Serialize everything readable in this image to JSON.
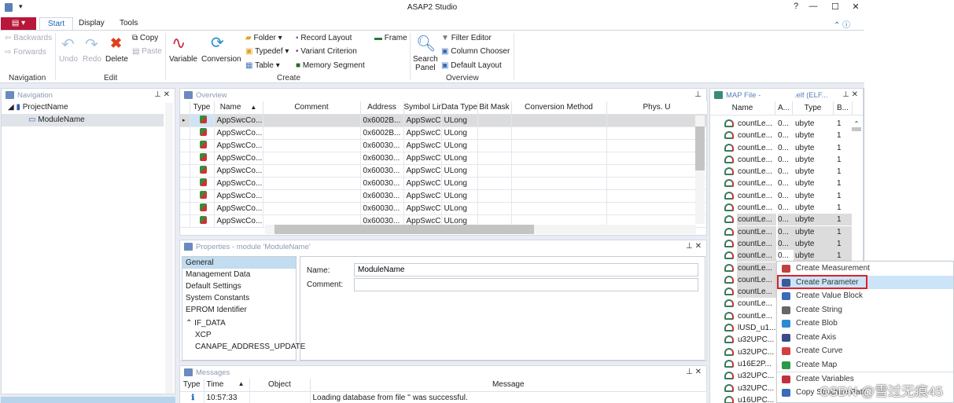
{
  "app": {
    "title": "ASAP2 Studio"
  },
  "tabs": [
    {
      "label": "Start"
    },
    {
      "label": "Display"
    },
    {
      "label": "Tools"
    }
  ],
  "ribbon": {
    "navigation": {
      "label": "Navigation",
      "backwards": "Backwards",
      "forwards": "Forwards"
    },
    "edit": {
      "label": "Edit",
      "undo": "Undo",
      "redo": "Redo",
      "delete": "Delete",
      "copy": "Copy",
      "paste": "Paste"
    },
    "create": {
      "label": "Create",
      "variable": "Variable",
      "conversion": "Conversion",
      "folder": "Folder",
      "typedef": "Typedef",
      "table": "Table",
      "record_layout": "Record Layout",
      "variant_criterion": "Variant Criterion",
      "memory_segment": "Memory Segment",
      "frame": "Frame"
    },
    "overview": {
      "label": "Overview",
      "search_panel_1": "Search",
      "search_panel_2": "Panel",
      "filter_editor": "Filter Editor",
      "column_chooser": "Column Chooser",
      "default_layout": "Default Layout"
    }
  },
  "navigation_panel": {
    "title": "Navigation",
    "tree": [
      {
        "label": "ProjectName"
      },
      {
        "label": "ModuleName"
      }
    ]
  },
  "overview_panel": {
    "title": "Overview",
    "columns": [
      "Type",
      "Name",
      "Comment",
      "Address",
      "Symbol Link",
      "Data Type",
      "Bit Mask",
      "Conversion Method",
      "Phys. U"
    ],
    "rows": [
      [
        "AppSwcCo...",
        "",
        "0x6002B...",
        "AppSwcC...",
        "ULong"
      ],
      [
        "AppSwcCo...",
        "",
        "0x6002B...",
        "AppSwcC...",
        "ULong"
      ],
      [
        "AppSwcCo...",
        "",
        "0x60030...",
        "AppSwcC...",
        "ULong"
      ],
      [
        "AppSwcCo...",
        "",
        "0x60030...",
        "AppSwcC...",
        "ULong"
      ],
      [
        "AppSwcCo...",
        "",
        "0x60030...",
        "AppSwcC...",
        "ULong"
      ],
      [
        "AppSwcCo...",
        "",
        "0x60030...",
        "AppSwcC...",
        "ULong"
      ],
      [
        "AppSwcCo...",
        "",
        "0x60030...",
        "AppSwcC...",
        "ULong"
      ],
      [
        "AppSwcCo...",
        "",
        "0x60030...",
        "AppSwcC...",
        "ULong"
      ],
      [
        "AppSwcCo...",
        "",
        "0x60030...",
        "AppSwcC...",
        "ULong"
      ]
    ]
  },
  "properties_panel": {
    "title": "Properties - module 'ModuleName'",
    "sections": [
      "General",
      "Management Data",
      "Default Settings",
      "System Constants",
      "EPROM Identifier"
    ],
    "if_data": {
      "label": "IF_DATA",
      "children": [
        "XCP",
        "CANAPE_ADDRESS_UPDATE"
      ]
    },
    "name_label": "Name:",
    "name_value": "ModuleName",
    "comment_label": "Comment:",
    "comment_value": ""
  },
  "messages_panel": {
    "title": "Messages",
    "columns": [
      "Type",
      "Time",
      "Object",
      "Message"
    ],
    "rows": [
      {
        "time": "10:57:33",
        "object": "",
        "message": "Loading database from file '' was successful."
      }
    ]
  },
  "map_panel": {
    "title": "MAP File - ",
    "title_suffix": ".elf (ELF...",
    "columns": [
      "Name",
      "A...",
      "Type",
      "B..."
    ],
    "rows": [
      [
        "countLe...",
        "0...",
        "ubyte",
        "1"
      ],
      [
        "countLe...",
        "0...",
        "ubyte",
        "1"
      ],
      [
        "countLe...",
        "0...",
        "ubyte",
        "1"
      ],
      [
        "countLe...",
        "0...",
        "ubyte",
        "1"
      ],
      [
        "countLe...",
        "0...",
        "ubyte",
        "1"
      ],
      [
        "countLe...",
        "0...",
        "ubyte",
        "1"
      ],
      [
        "countLe...",
        "0...",
        "ubyte",
        "1"
      ],
      [
        "countLe...",
        "0...",
        "ubyte",
        "1"
      ],
      [
        "countLe...",
        "0...",
        "ubyte",
        "1"
      ],
      [
        "countLe...",
        "0...",
        "ubyte",
        "1"
      ],
      [
        "countLe...",
        "0...",
        "ubyte",
        "1"
      ],
      [
        "countLe...",
        "0...",
        "ubyte",
        "1"
      ],
      [
        "countLe...",
        "",
        "",
        ""
      ],
      [
        "countLe...",
        "",
        "",
        ""
      ],
      [
        "countLe...",
        "",
        "",
        ""
      ],
      [
        "countLe...",
        "",
        "",
        ""
      ],
      [
        "countLe...",
        "",
        "",
        ""
      ],
      [
        "lUSD_u1...",
        "",
        "",
        ""
      ],
      [
        "u32UPC...",
        "",
        "",
        ""
      ],
      [
        "u32UPC...",
        "",
        "",
        ""
      ],
      [
        "u16E2P...",
        "",
        "",
        ""
      ],
      [
        "u32UPC...",
        "",
        "",
        ""
      ],
      [
        "u32UPC...",
        "",
        "",
        ""
      ],
      [
        "u16UPC...",
        "",
        "",
        ""
      ]
    ],
    "selected_rows": [
      8,
      9,
      10,
      11,
      12,
      13,
      14
    ]
  },
  "context_menu": {
    "items": [
      {
        "label": "Create Measurement",
        "icon": "measurement-icon"
      },
      {
        "label": "Create Parameter",
        "icon": "parameter-icon",
        "highlighted": true
      },
      {
        "label": "Create Value Block",
        "icon": "value-block-icon"
      },
      {
        "label": "Create String",
        "icon": "string-icon"
      },
      {
        "label": "Create Blob",
        "icon": "blob-icon"
      },
      {
        "label": "Create Axis",
        "icon": "axis-icon"
      },
      {
        "label": "Create Curve",
        "icon": "curve-icon"
      },
      {
        "label": "Create Map",
        "icon": "map-icon"
      },
      {
        "label": "Create Variables",
        "icon": "variables-icon"
      },
      {
        "label": "Copy Structure Path",
        "icon": "copy-icon"
      }
    ]
  },
  "watermark": "CSDN @雪过无痕45",
  "colors": {
    "accent": "#1f64b4",
    "file_tab": "#b8173a",
    "highlight": "#cce4f7",
    "highlight_border": "#e0202a",
    "selection": "#dcdcdc"
  }
}
